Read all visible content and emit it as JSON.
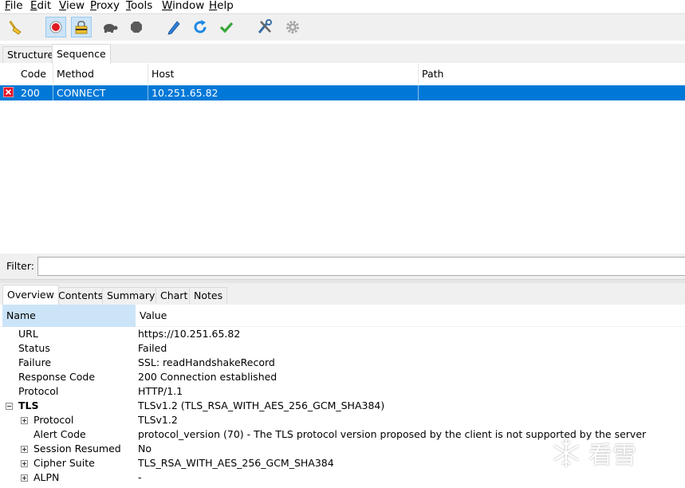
{
  "menu": [
    "File",
    "Edit",
    "View",
    "Proxy",
    "Tools",
    "Window",
    "Help"
  ],
  "menu_mnemonics": [
    "F",
    "E",
    "V",
    "P",
    "T",
    "W",
    "H"
  ],
  "toolbar": {
    "icons": [
      "broom-icon",
      "record-icon",
      "throttle-icon",
      "turtle-icon",
      "stop-icon",
      "pen-icon",
      "refresh-icon",
      "check-icon",
      "tools-icon",
      "gear-icon"
    ]
  },
  "tabs_top": [
    "Structure",
    "Sequence"
  ],
  "grid": {
    "columns": [
      "Code",
      "Method",
      "Host",
      "Path"
    ],
    "rows": [
      {
        "status_icon": "error-icon",
        "code": "200",
        "method": "CONNECT",
        "host": "10.251.65.82",
        "path": ""
      }
    ]
  },
  "filter": {
    "label": "Filter:",
    "value": ""
  },
  "tabs_bottom": [
    "Overview",
    "Contents",
    "Summary",
    "Chart",
    "Notes"
  ],
  "overview": {
    "header_name": "Name",
    "header_value": "Value",
    "rows": [
      {
        "name": "URL",
        "value": "https://10.251.65.82"
      },
      {
        "name": "Status",
        "value": "Failed"
      },
      {
        "name": "Failure",
        "value": "SSL: readHandshakeRecord"
      },
      {
        "name": "Response Code",
        "value": "200 Connection established"
      },
      {
        "name": "Protocol",
        "value": "HTTP/1.1"
      },
      {
        "name": "TLS",
        "value": "TLSv1.2 (TLS_RSA_WITH_AES_256_GCM_SHA384)"
      },
      {
        "name": "Protocol",
        "value": "TLSv1.2"
      },
      {
        "name": "Alert Code",
        "value": "protocol_version (70) - The TLS protocol version proposed by the client is not supported by the server"
      },
      {
        "name": "Session Resumed",
        "value": "No"
      },
      {
        "name": "Cipher Suite",
        "value": "TLS_RSA_WITH_AES_256_GCM_SHA384"
      },
      {
        "name": "ALPN",
        "value": "-"
      }
    ]
  },
  "watermark": {
    "text": "看雪"
  },
  "colors": {
    "selection": "#0078d7",
    "header_highlight": "#cce4f7",
    "error": "#e81123"
  }
}
